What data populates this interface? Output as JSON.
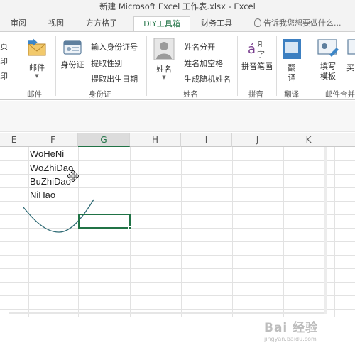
{
  "window": {
    "title": "新建 Microsoft Excel 工作表.xlsx - Excel"
  },
  "tabs": [
    {
      "label": "审阅"
    },
    {
      "label": "视图"
    },
    {
      "label": "方方格子"
    },
    {
      "label": "DIY工具箱",
      "active": true
    },
    {
      "label": "财务工具"
    }
  ],
  "tell_me": {
    "icon": "lightbulb-icon",
    "placeholder": "告诉我您想要做什么..."
  },
  "ribbon": {
    "left_partial_items": [
      "页",
      "印",
      "印"
    ],
    "groups": [
      {
        "name": "邮件",
        "buttons": [
          {
            "label": "邮件",
            "icon": "envelope-icon",
            "has_dropdown": true
          }
        ]
      },
      {
        "name": "身份证",
        "buttons": [
          {
            "label": "身份证",
            "icon": "id-card-icon",
            "has_dropdown": true
          },
          {
            "label": "输入身份证号",
            "icon": "id-input-icon"
          },
          {
            "label": "提取性别",
            "icon": "gender-icon"
          },
          {
            "label": "提取出生日期",
            "icon": "birthday-icon"
          }
        ]
      },
      {
        "name": "姓名",
        "buttons": [
          {
            "label": "姓名",
            "icon": "person-icon",
            "has_dropdown": true
          },
          {
            "label": "姓名分开",
            "icon": "name-split-icon"
          },
          {
            "label": "姓名加空格",
            "icon": "name-space-icon"
          },
          {
            "label": "生成随机姓名",
            "icon": "random-name-icon"
          }
        ]
      },
      {
        "name": "拼音",
        "buttons": [
          {
            "label": "拼音笔画",
            "icon": "pinyin-icon",
            "has_dropdown": true
          }
        ]
      },
      {
        "name": "翻译",
        "buttons": [
          {
            "label": "翻译",
            "icon": "translate-icon"
          }
        ]
      },
      {
        "name": "邮件合并",
        "buttons": [
          {
            "label": "填写模板",
            "icon": "fill-template-icon"
          },
          {
            "label": "买",
            "icon": "partial-icon"
          }
        ]
      }
    ]
  },
  "sheet": {
    "columns": [
      "E",
      "F",
      "G",
      "H",
      "I",
      "J",
      "K"
    ],
    "selected_column": "G",
    "cells": [
      {
        "ref": "F1",
        "value": "WoHeNi"
      },
      {
        "ref": "F2",
        "value": "WoZhiDao"
      },
      {
        "ref": "F3",
        "value": "BuZhiDao"
      },
      {
        "ref": "F4",
        "value": "NiHao"
      }
    ],
    "active_cell": "G6"
  },
  "annotation": {
    "type": "hand-drawn-curve",
    "color": "#2f6b75"
  },
  "watermark": {
    "text": "Bai 经验",
    "subtext": "jingyan.baidu.com"
  },
  "colors": {
    "accent": "#217346",
    "grid": "#e2e2e2"
  }
}
